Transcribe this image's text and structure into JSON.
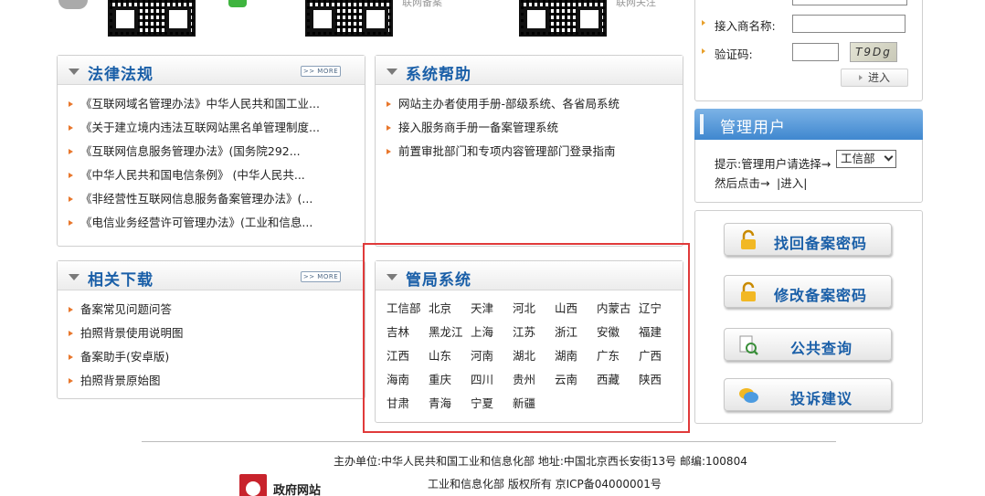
{
  "top": {
    "qr_captions": [
      "联网备案",
      "联网关注"
    ]
  },
  "laws": {
    "title": "法律法规",
    "more": ">> MORE",
    "items": [
      "《互联网域名管理办法》中华人民共和国工业...",
      "《关于建立境内违法互联网站黑名单管理制度...",
      "《互联网信息服务管理办法》(国务院292...",
      "《中华人民共和国电信条例》 (中华人民共...",
      "《非经营性互联网信息服务备案管理办法》(...",
      "《电信业务经营许可管理办法》(工业和信息..."
    ]
  },
  "help": {
    "title": "系统帮助",
    "items": [
      "网站主办者使用手册-部级系统、各省局系统",
      "接入服务商手册一备案管理系统",
      "前置审批部门和专项内容管理部门登录指南"
    ]
  },
  "downloads": {
    "title": "相关下载",
    "more": ">> MORE",
    "items": [
      "备案常见问题问答",
      "拍照背景使用说明图",
      "备案助手(安卓版)",
      "拍照背景原始图"
    ]
  },
  "bureau": {
    "title": "管局系统",
    "rows": [
      [
        "工信部",
        "北京",
        "天津",
        "河北",
        "山西",
        "内蒙古",
        "辽宁"
      ],
      [
        "吉林",
        "黑龙江",
        "上海",
        "江苏",
        "浙江",
        "安徽",
        "福建"
      ],
      [
        "江西",
        "山东",
        "河南",
        "湖北",
        "湖南",
        "广东",
        "广西"
      ],
      [
        "海南",
        "重庆",
        "四川",
        "贵州",
        "云南",
        "西藏",
        "陕西"
      ],
      [
        "甘肃",
        "青海",
        "宁夏",
        "新疆"
      ]
    ]
  },
  "login": {
    "access_label": "接入商名称:",
    "captcha_label": "验证码:",
    "captcha_text": "T9Dg",
    "enter": "进入"
  },
  "admin": {
    "title": "管理用户",
    "hint": "提示:管理用户请选择→",
    "select_value": "工信部",
    "then": "然后点击→",
    "enter": "|进入|"
  },
  "actions": [
    {
      "label": "找回备案密码"
    },
    {
      "label": "修改备案密码"
    },
    {
      "label": "公共查询"
    },
    {
      "label": "投诉建议"
    }
  ],
  "footer": {
    "line1": "主办单位:中华人民共和国工业和信息化部 地址:中国北京西长安街13号 邮编:100804",
    "line2": "工业和信息化部 版权所有 京ICP备04000001号",
    "gov_site": "政府网站"
  },
  "colors": {
    "accent": "#1a5fa8",
    "bullet": "#e8772c",
    "highlight": "#e03a3a"
  }
}
